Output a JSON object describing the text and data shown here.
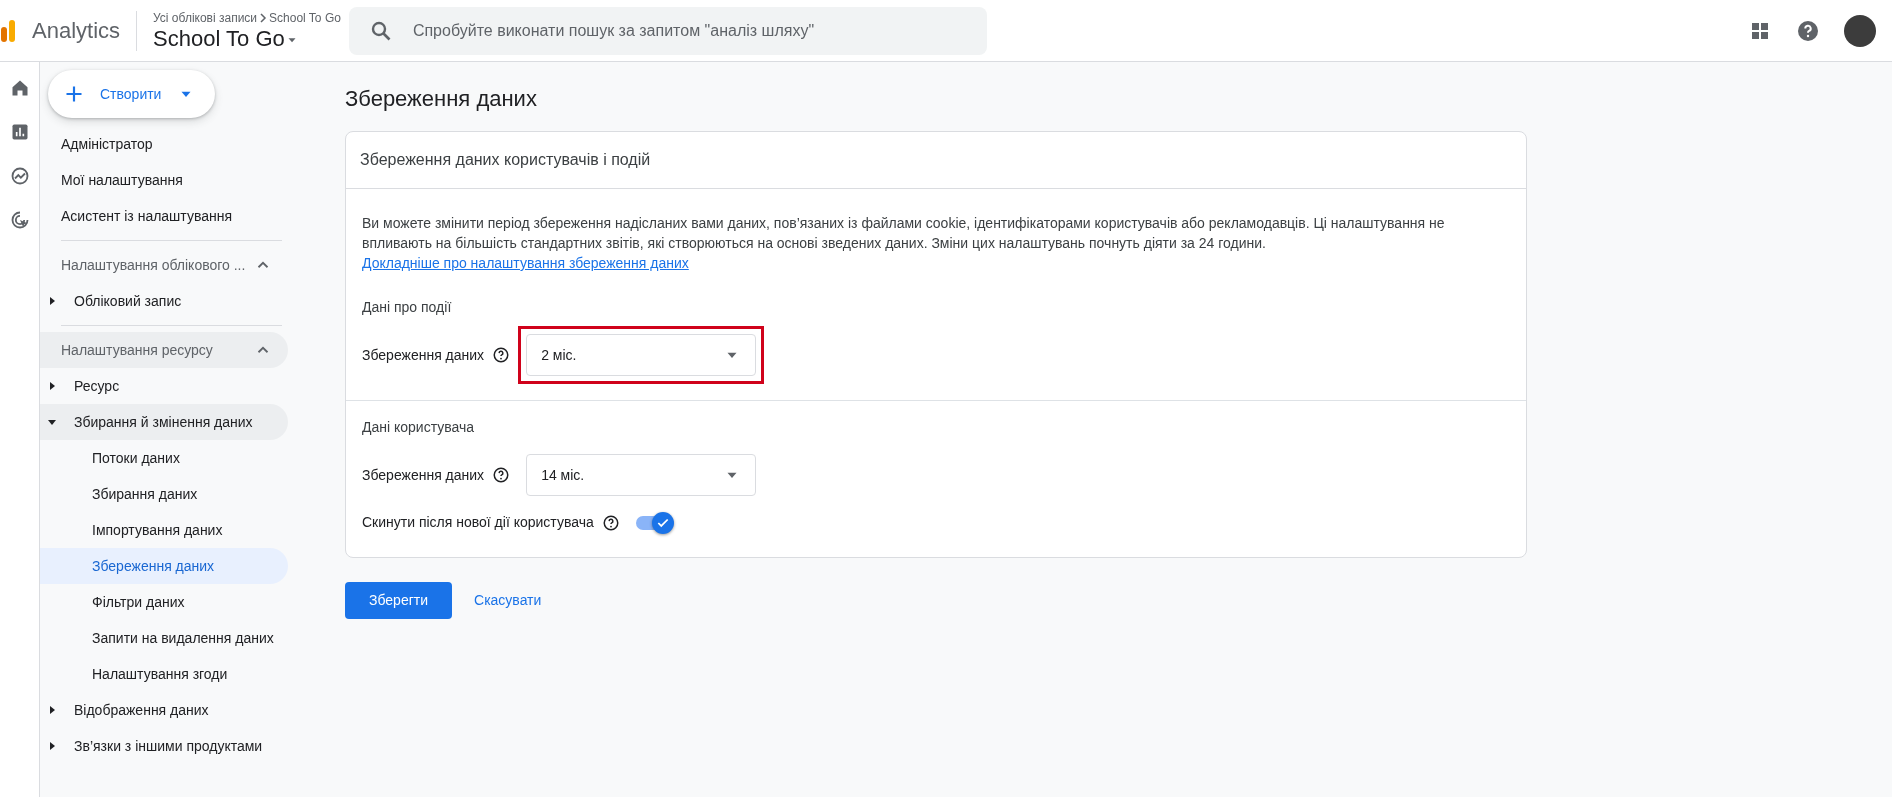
{
  "header": {
    "product": "Analytics",
    "breadcrumb_root": "Усі облікові записи",
    "breadcrumb_current": "School To Go",
    "property": "School To Go",
    "search": {
      "placeholder": "Спробуйте виконати пошук за запитом \"аналіз шляху\""
    }
  },
  "sidebar": {
    "create_button": "Створити",
    "top_links": [
      "Адміністратор",
      "Мої налаштування",
      "Асистент із налаштування"
    ],
    "sections": [
      {
        "title": "Налаштування облікового ...",
        "expanded": true,
        "highlighted": false,
        "groups": [
          {
            "label": "Обліковий запис",
            "expanded": false
          }
        ]
      },
      {
        "title": "Налаштування ресурсу",
        "expanded": true,
        "highlighted": true,
        "groups": [
          {
            "label": "Ресурс",
            "expanded": false
          },
          {
            "label": "Збирання й змінення даних",
            "expanded": true,
            "children": [
              {
                "label": "Потоки даних",
                "selected": false
              },
              {
                "label": "Збирання даних",
                "selected": false
              },
              {
                "label": "Імпортування даних",
                "selected": false
              },
              {
                "label": "Збереження даних",
                "selected": true
              },
              {
                "label": "Фільтри даних",
                "selected": false
              },
              {
                "label": "Запити на видалення даних",
                "selected": false
              },
              {
                "label": "Налаштування згоди",
                "selected": false
              }
            ]
          },
          {
            "label": "Відображення даних",
            "expanded": false
          },
          {
            "label": "Зв’язки з іншими продуктами",
            "expanded": false
          }
        ]
      }
    ]
  },
  "main": {
    "title": "Збереження даних",
    "card": {
      "title": "Збереження даних користувачів і подій",
      "description": "Ви можете змінити період збереження надісланих вами даних, пов’язаних із файлами cookie, ідентифікаторами користувачів або рекламодавців. Ці налаштування не впливають на більшість стандартних звітів, які створюються на основі зведених даних. Зміни цих налаштувань почнуть діяти за 24 години.",
      "link": "Докладніше про налаштування збереження даних",
      "sections": [
        {
          "heading": "Дані про події",
          "fields": [
            {
              "kind": "select",
              "label": "Збереження даних",
              "value": "2 міс.",
              "highlighted": true
            }
          ]
        },
        {
          "heading": "Дані користувача",
          "fields": [
            {
              "kind": "select",
              "label": "Збереження даних",
              "value": "14 міс.",
              "highlighted": false
            },
            {
              "kind": "toggle",
              "label": "Скинути після нової дії користувача",
              "on": true
            }
          ]
        }
      ]
    },
    "buttons": {
      "save": "Зберегти",
      "cancel": "Скасувати"
    }
  }
}
